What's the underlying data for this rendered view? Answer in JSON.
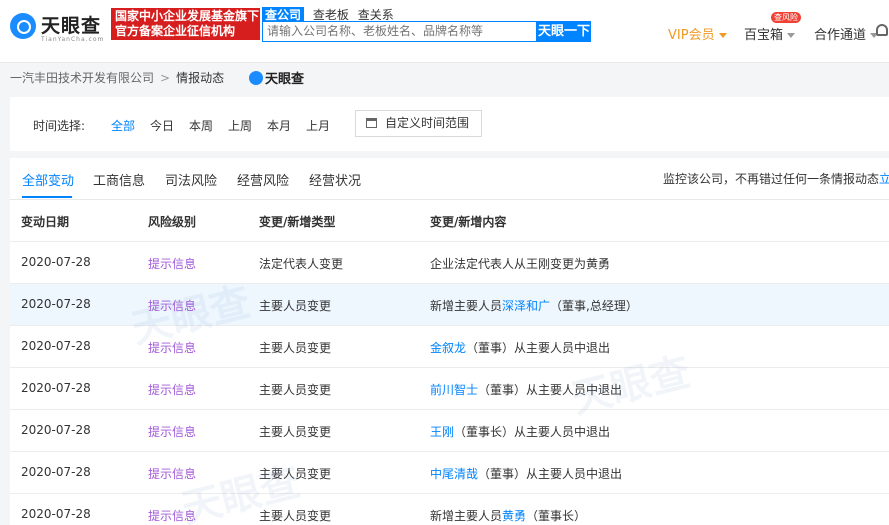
{
  "header": {
    "logo_text": "天眼查",
    "logo_sub": "TianYanCha.com",
    "banner_line1": "国家中小企业发展基金旗下",
    "banner_line2": "官方备案企业征信机构",
    "search_tabs": [
      "查公司",
      "查老板",
      "查关系"
    ],
    "search_placeholder": "请输入公司名称、老板姓名、品牌名称等",
    "search_button": "天眼一下",
    "nav": {
      "vip": "VIP会员",
      "baibaoxiang": "百宝箱",
      "baibaoxiang_badge": "查风险",
      "coop": "合作通道"
    }
  },
  "breadcrumb": {
    "company": "一汽丰田技术开发有限公司",
    "separator": ">",
    "current": "情报动态",
    "mini_logo": "天眼查"
  },
  "time_filter": {
    "label": "时间选择:",
    "options": [
      "全部",
      "今日",
      "本周",
      "上周",
      "本月",
      "上月"
    ],
    "selected": "全部",
    "custom_range": "自定义时间范围"
  },
  "tabs": {
    "items": [
      "全部变动",
      "工商信息",
      "司法风险",
      "经营风险",
      "经营状况"
    ],
    "active": "全部变动",
    "monitor_text": "监控该公司，不再错过任何一条情报动态",
    "monitor_link": "立"
  },
  "table": {
    "headers": [
      "变动日期",
      "风险级别",
      "变更/新增类型",
      "变更/新增内容"
    ],
    "rows": [
      {
        "date": "2020-07-28",
        "risk": "提示信息",
        "type": "法定代表人变更",
        "pre": "企业法定代表人从王刚变更为黄勇",
        "link": "",
        "post": ""
      },
      {
        "date": "2020-07-28",
        "risk": "提示信息",
        "type": "主要人员变更",
        "pre": "新增主要人员",
        "link": "深泽和广",
        "post": "（董事,总经理）"
      },
      {
        "date": "2020-07-28",
        "risk": "提示信息",
        "type": "主要人员变更",
        "pre": "",
        "link": "金叙龙",
        "post": "（董事）从主要人员中退出"
      },
      {
        "date": "2020-07-28",
        "risk": "提示信息",
        "type": "主要人员变更",
        "pre": "",
        "link": "前川智士",
        "post": "（董事）从主要人员中退出"
      },
      {
        "date": "2020-07-28",
        "risk": "提示信息",
        "type": "主要人员变更",
        "pre": "",
        "link": "王刚",
        "post": "（董事长）从主要人员中退出"
      },
      {
        "date": "2020-07-28",
        "risk": "提示信息",
        "type": "主要人员变更",
        "pre": "",
        "link": "中尾清哉",
        "post": "（董事）从主要人员中退出"
      },
      {
        "date": "2020-07-28",
        "risk": "提示信息",
        "type": "主要人员变更",
        "pre": "新增主要人员",
        "link": "黄勇",
        "post": "（董事长）"
      }
    ]
  },
  "watermark": "天眼查",
  "colors": {
    "accent": "#0084ff",
    "vip": "#f09a26",
    "risk": "#a25ad9",
    "banner": "#d61e1e"
  }
}
